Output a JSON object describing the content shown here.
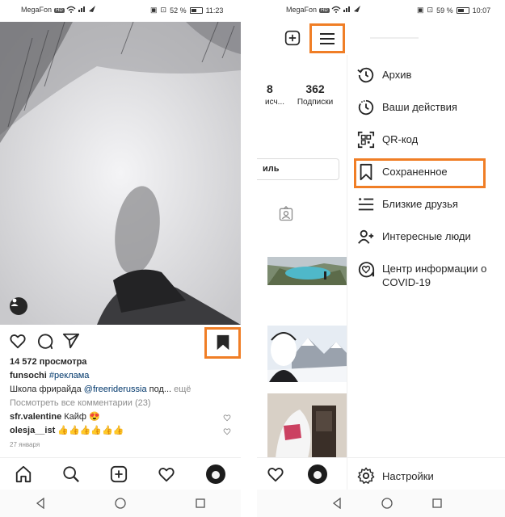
{
  "left": {
    "status": {
      "carrier": "MegaFon",
      "carrier_badge": "HD",
      "battery": "52 %",
      "time": "11:23",
      "battery_fill": 0.52
    },
    "post": {
      "views": "14 572 просмотра",
      "author": "funsochi",
      "hashtag": "#реклама",
      "caption_start": "Школа фрирайда",
      "mention": "@freeriderussia",
      "caption_rest": "под...",
      "more": "ещё",
      "view_comments": "Посмотреть все комментарии (23)",
      "comments": [
        {
          "user": "sfr.valentine",
          "text": "Кайф 😍"
        },
        {
          "user": "olesja__ist",
          "text": "👍👍👍👍👍👍"
        }
      ],
      "date": "27 января"
    }
  },
  "right": {
    "status": {
      "carrier": "MegaFon",
      "carrier_badge": "HD",
      "battery": "59 %",
      "time": "10:07",
      "battery_fill": 0.59
    },
    "profile": {
      "posts_count": "8",
      "posts_label": "исч...",
      "following_count": "362",
      "following_label": "Подписки",
      "edit_label": "иль"
    },
    "menu": {
      "items": [
        {
          "icon": "archive-icon",
          "label": "Архив"
        },
        {
          "icon": "activity-icon",
          "label": "Ваши действия"
        },
        {
          "icon": "qr-code-icon",
          "label": "QR-код"
        },
        {
          "icon": "bookmark-icon",
          "label": "Сохраненное"
        },
        {
          "icon": "close-friends-icon",
          "label": "Близкие друзья"
        },
        {
          "icon": "discover-people-icon",
          "label": "Интересные люди"
        },
        {
          "icon": "covid-info-icon",
          "label": "Центр информации о COVID-19"
        }
      ],
      "settings": "Настройки"
    }
  },
  "colors": {
    "highlight": "#f07e26",
    "link": "#00376b",
    "muted": "#8e8e8e",
    "text": "#262626"
  }
}
